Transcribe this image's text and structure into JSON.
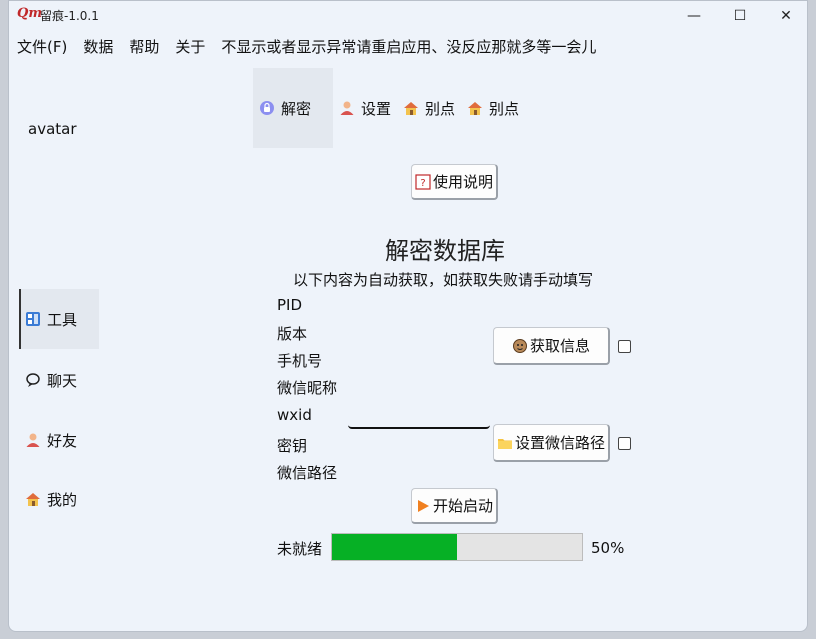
{
  "window": {
    "title": "留痕-1.0.1",
    "logo_text": "Qm",
    "controls": {
      "minimize": "—",
      "maximize": "☐",
      "close": "✕"
    }
  },
  "menu": [
    "文件(F)",
    "数据",
    "帮助",
    "关于",
    "不显示或者显示异常请重启应用、没反应那就多等一会儿"
  ],
  "sidebar": {
    "avatar": "avatar",
    "items": [
      {
        "label": "工具",
        "icon": "tool-icon",
        "active": true
      },
      {
        "label": "聊天",
        "icon": "chat-icon",
        "active": false
      },
      {
        "label": "好友",
        "icon": "person-icon",
        "active": false
      },
      {
        "label": "我的",
        "icon": "home-icon",
        "active": false
      }
    ]
  },
  "tabs": [
    {
      "label": "解密",
      "icon": "decrypt-icon",
      "active": true
    },
    {
      "label": "设置",
      "icon": "person-icon",
      "active": false
    },
    {
      "label": "别点",
      "icon": "house-icon",
      "active": false
    },
    {
      "label": "别点",
      "icon": "house-icon",
      "active": false
    }
  ],
  "main": {
    "help_button": "使用说明",
    "heading": "解密数据库",
    "subtitle": "以下内容为自动获取，如获取失败请手动填写",
    "fields": [
      "PID",
      "版本",
      "手机号",
      "微信昵称",
      "wxid",
      "密钥",
      "微信路径"
    ],
    "wxid_value": "",
    "get_info_button": "获取信息",
    "set_path_button": "设置微信路径",
    "start_button": "开始启动",
    "status_label": "未就绪",
    "progress_value": 0.5,
    "progress_text": "50%"
  },
  "colors": {
    "progress_fill": "#06b025",
    "progress_track": "#e4e4e4",
    "window_bg": "#eef3fa",
    "active_tab_bg": "#e3e8ef"
  }
}
